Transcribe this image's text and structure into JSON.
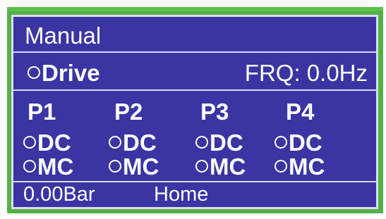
{
  "screen": {
    "title": "Manual",
    "drive_label": "Drive",
    "frequency": "FRQ: 0.0Hz",
    "pumps": [
      {
        "label": "P1",
        "dc": "DC",
        "mc": "MC"
      },
      {
        "label": "P2",
        "dc": "DC",
        "mc": "MC"
      },
      {
        "label": "P3",
        "dc": "DC",
        "mc": "MC"
      },
      {
        "label": "P4",
        "dc": "DC",
        "mc": "MC"
      }
    ],
    "pressure": "0.00Bar",
    "home_label": "Home"
  },
  "colors": {
    "bezel": "#55b048",
    "screen_bg": "#3a35a2",
    "text": "#ffffff",
    "separator": "#d9d9f0"
  },
  "icons": {
    "status_indicator": "circle-outline-icon"
  }
}
